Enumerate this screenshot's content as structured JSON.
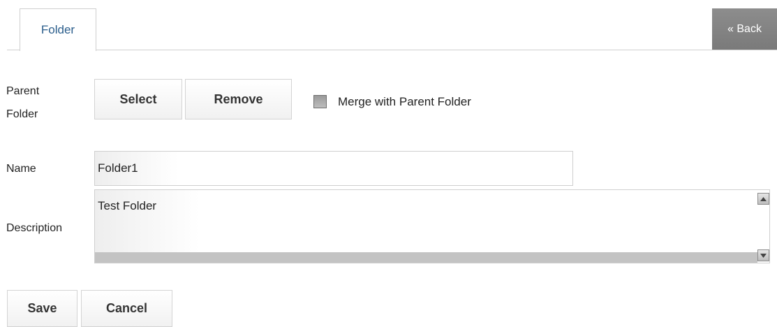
{
  "tabs": [
    {
      "label": "Folder"
    }
  ],
  "back_button": {
    "label": "« Back"
  },
  "parent_folder": {
    "label_line1": "Parent",
    "label_line2": "Folder",
    "select_label": "Select",
    "remove_label": "Remove",
    "merge_label": "Merge with Parent Folder",
    "merge_checked": false
  },
  "name": {
    "label": "Name",
    "value": "Folder1"
  },
  "description": {
    "label": "Description",
    "value": "Test Folder"
  },
  "actions": {
    "save_label": "Save",
    "cancel_label": "Cancel"
  },
  "icons": {
    "scroll_up": "arrow-up-icon",
    "scroll_down": "arrow-down-icon"
  },
  "colors": {
    "tab_text": "#2b5e8c",
    "back_button_bg": "#808080"
  }
}
